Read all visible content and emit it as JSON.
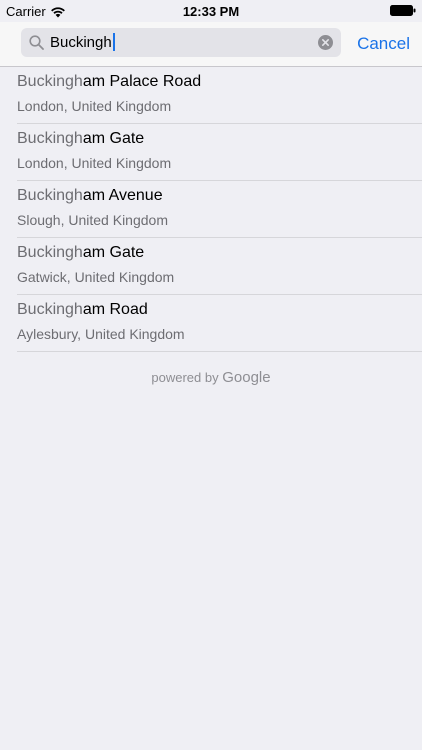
{
  "status_bar": {
    "carrier": "Carrier",
    "time": "12:33 PM"
  },
  "search": {
    "query": "Buckingh",
    "cancel_label": "Cancel",
    "icon": "search-icon",
    "clear_icon": "clear-icon"
  },
  "results": [
    {
      "match": "Buckingh",
      "rest": "am Palace Road",
      "subtitle": "London, United Kingdom"
    },
    {
      "match": "Buckingh",
      "rest": "am Gate",
      "subtitle": "London, United Kingdom"
    },
    {
      "match": "Buckingh",
      "rest": "am Avenue",
      "subtitle": "Slough, United Kingdom"
    },
    {
      "match": "Buckingh",
      "rest": "am Gate",
      "subtitle": "Gatwick, United Kingdom"
    },
    {
      "match": "Buckingh",
      "rest": "am Road",
      "subtitle": "Aylesbury, United Kingdom"
    }
  ],
  "attribution": {
    "prefix": "powered by",
    "brand": "Google"
  },
  "colors": {
    "accent": "#1a73e8",
    "background": "#efeff4",
    "secondary_text": "#6d6d72"
  }
}
